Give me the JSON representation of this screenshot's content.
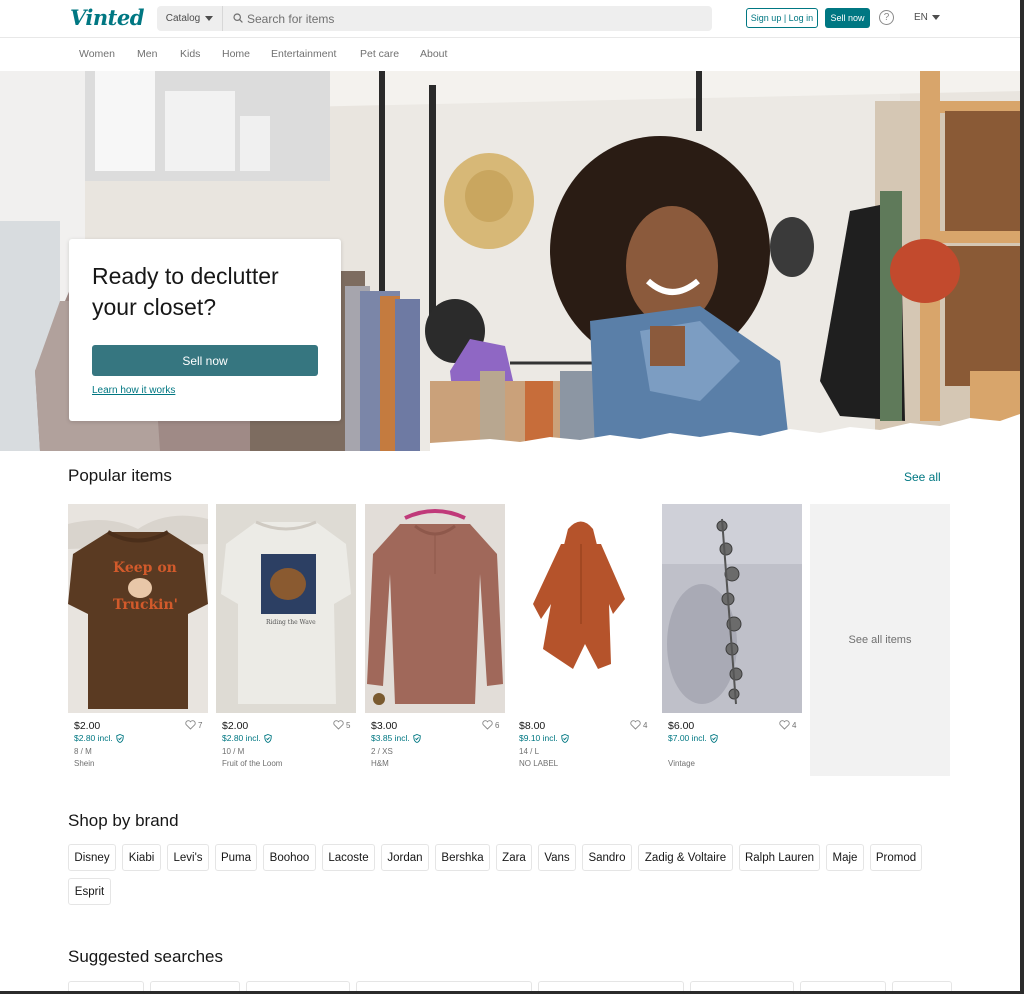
{
  "header": {
    "logo": "Vinted",
    "catalog_label": "Catalog",
    "search_placeholder": "Search for items",
    "signup_label": "Sign up | Log in",
    "sell_label": "Sell now",
    "help_glyph": "?",
    "language": "EN"
  },
  "nav": {
    "items": [
      "Women",
      "Men",
      "Kids",
      "Home",
      "Entertainment",
      "Pet care",
      "About"
    ]
  },
  "hero": {
    "title": "Ready to declutter your closet?",
    "sell_button": "Sell now",
    "learn_link": "Learn how it works"
  },
  "popular": {
    "title": "Popular items",
    "see_all": "See all",
    "see_all_items": "See all items",
    "items": [
      {
        "price": "$2.00",
        "favorites": "7",
        "incl": "$2.80 incl.",
        "size": "8 / M",
        "brand": "Shein"
      },
      {
        "price": "$2.00",
        "favorites": "5",
        "incl": "$2.80 incl.",
        "size": "10 / M",
        "brand": "Fruit of the Loom"
      },
      {
        "price": "$3.00",
        "favorites": "6",
        "incl": "$3.85 incl.",
        "size": "2 / XS",
        "brand": "H&M"
      },
      {
        "price": "$8.00",
        "favorites": "4",
        "incl": "$9.10 incl.",
        "size": "14 / L",
        "brand": "NO LABEL"
      },
      {
        "price": "$6.00",
        "favorites": "4",
        "incl": "$7.00 incl.",
        "size": "",
        "brand": "Vintage"
      }
    ]
  },
  "brands": {
    "title": "Shop by brand",
    "items": [
      "Disney",
      "Kiabi",
      "Levi's",
      "Puma",
      "Boohoo",
      "Lacoste",
      "Jordan",
      "Bershka",
      "Zara",
      "Vans",
      "Sandro",
      "Zadig & Voltaire",
      "Ralph Lauren",
      "Maje",
      "Promod",
      "Esprit"
    ]
  },
  "suggested": {
    "title": "Suggested searches"
  },
  "colors": {
    "brand": "#007782",
    "button": "#367680",
    "text": "#171717",
    "muted": "#707070"
  }
}
